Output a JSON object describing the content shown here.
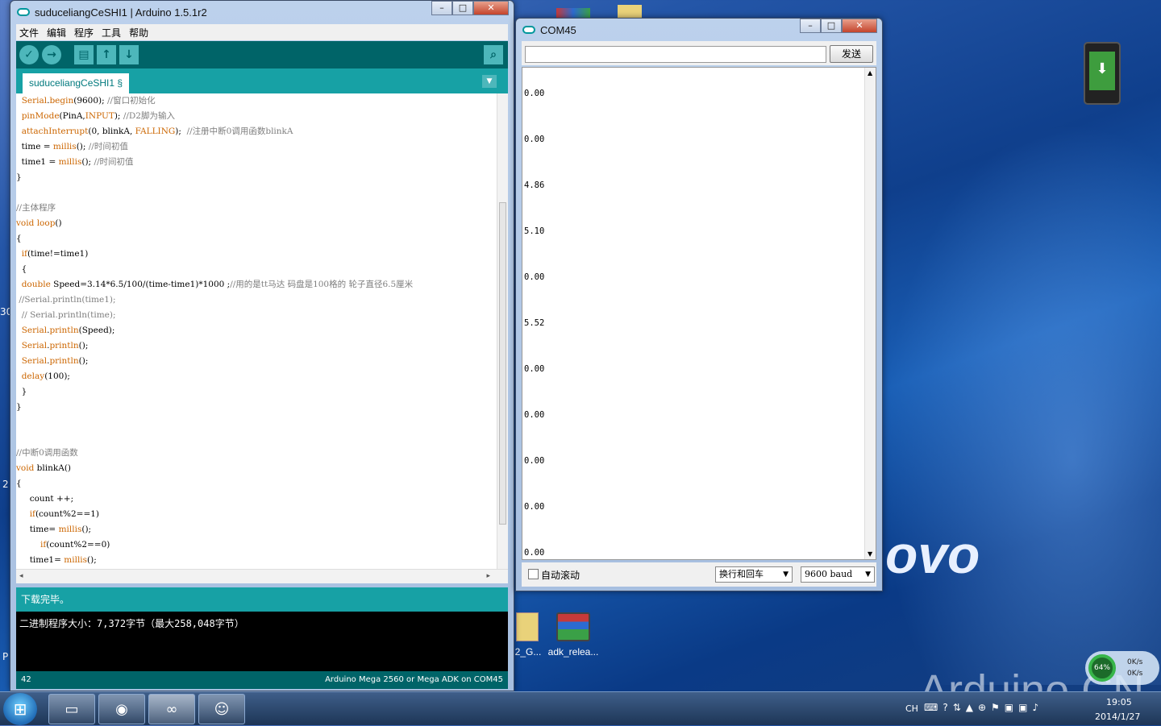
{
  "ide": {
    "title": "suduceliangCeSHI1 | Arduino 1.5.1r2",
    "menu": [
      "文件",
      "编辑",
      "程序",
      "工具",
      "帮助"
    ],
    "tab_label": "suduceliangCeSHI1 §",
    "code_lines": [
      "  Serial.begin(9600); //窗口初始化",
      "  pinMode(PinA,INPUT); //D2脚为输入",
      "  attachInterrupt(0, blinkA, FALLING);  //注册中断0调用函数blinkA",
      "  time = millis(); //时间初值",
      "  time1 = millis(); //时间初值",
      "}",
      "",
      "//主体程序",
      "void loop()",
      "{",
      "  if(time!=time1)",
      "  {",
      "  double Speed=3.14*6.5/100/(time-time1)*1000 ;//用的是tt马达 码盘是100格的 轮子直径6.5厘米",
      " //Serial.println(time1);",
      "  // Serial.println(time);",
      "  Serial.println(Speed);",
      "  Serial.println();",
      "  Serial.println();",
      "  delay(100);",
      "  }",
      "}",
      "",
      "",
      "//中断0调用函数",
      "void blinkA()",
      "{",
      "     count ++;",
      "     if(count%2==1)",
      "     time= millis();",
      "         if(count%2==0)",
      "     time1= millis();"
    ],
    "status": "下载完毕。",
    "console": "二进制程序大小：7,372字节（最大258,048字节）",
    "line_number": "42",
    "board": "Arduino Mega 2560 or Mega ADK on COM45"
  },
  "serial": {
    "title": "COM45",
    "send_label": "发送",
    "input_value": "",
    "output": [
      "0.00",
      "0.00",
      "4.86",
      "5.10",
      "0.00",
      "5.52",
      "0.00",
      "0.00",
      "0.00",
      "0.00",
      "0.00"
    ],
    "autoscroll_label": "自动滚动",
    "autoscroll_checked": false,
    "line_ending": "换行和回车",
    "baud": "9600 baud"
  },
  "desktop": {
    "icons": [
      "2_G...",
      "adk_relea..."
    ],
    "watermark": "Arduino.CN",
    "logo_fragment": "ovo",
    "edge_digits": [
      "30",
      "2",
      "P"
    ]
  },
  "network": {
    "percent": "64%",
    "up": "0K/s",
    "down": "0K/s"
  },
  "tray": {
    "lang": "CH",
    "time": "19:05",
    "date": "2014/1/27"
  }
}
